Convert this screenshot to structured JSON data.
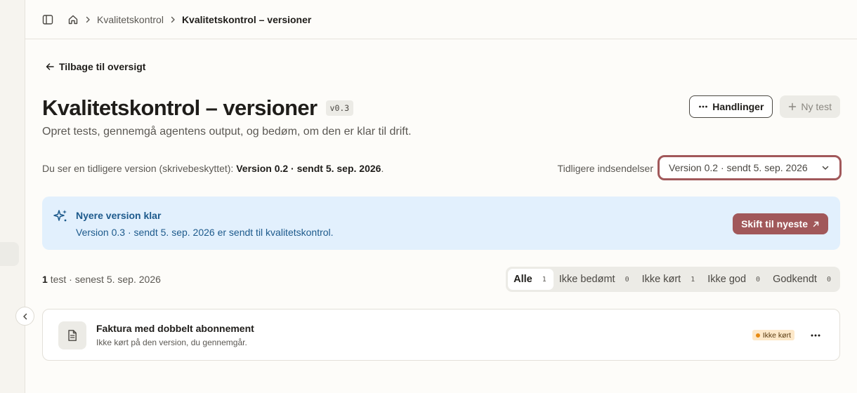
{
  "breadcrumb": {
    "items": [
      "Kvalitetskontrol",
      "Kvalitetskontrol – versioner"
    ]
  },
  "back_link": "Tilbage til oversigt",
  "page": {
    "title": "Kvalitetskontrol – versioner",
    "version_badge": "v0.3",
    "subtitle": "Opret tests, gennemgå agentens output, og bedøm, om den er klar til drift."
  },
  "actions": {
    "handlinger": "Handlinger",
    "new_test": "Ny test"
  },
  "readonly": {
    "prefix": "Du ser en tidligere version (skrivebeskyttet):",
    "version": "Version 0.2 · sendt 5. sep. 2026",
    "suffix": "."
  },
  "previous_submissions": {
    "label": "Tidligere indsendelser",
    "selected": "Version 0.2 · sendt 5. sep. 2026"
  },
  "notice": {
    "title": "Nyere version klar",
    "body": "Version 0.3 · sendt 5. sep. 2026 er sendt til kvalitetskontrol.",
    "button": "Skift til nyeste"
  },
  "summary": {
    "count": "1",
    "text": "test · senest 5. sep. 2026"
  },
  "filters": [
    {
      "label": "Alle",
      "count": "1"
    },
    {
      "label": "Ikke bedømt",
      "count": "0"
    },
    {
      "label": "Ikke kørt",
      "count": "1"
    },
    {
      "label": "Ikke god",
      "count": "0"
    },
    {
      "label": "Godkendt",
      "count": "0"
    }
  ],
  "tests": [
    {
      "title": "Faktura med dobbelt abonnement",
      "subtitle": "Ikke kørt på den version, du gennemgår.",
      "status": "Ikke kørt"
    }
  ],
  "colors": {
    "accent": "#a1585a",
    "notice_bg": "#e2f0fd",
    "notice_text": "#1d5a8c",
    "status_dot": "#e78a12"
  }
}
